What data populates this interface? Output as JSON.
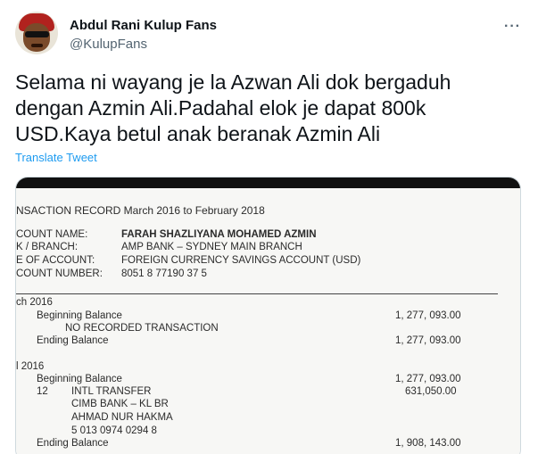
{
  "tweet": {
    "author_name": "Abdul Rani Kulup Fans",
    "author_handle": "@KulupFans",
    "more_icon": "more-horizontal-icon",
    "text_lines": [
      "Selama ni wayang je la Azwan Ali dok bergaduh",
      "dengan Azmin Ali.Padahal elok je dapat 800k",
      "USD.Kaya betul anak beranak Azmin Ali"
    ],
    "translate_label": "Translate Tweet"
  },
  "document": {
    "title": "NSACTION RECORD March 2016 to February 2018",
    "fields": [
      {
        "label": "COUNT NAME:",
        "value": "FARAH SHAZLIYANA MOHAMED AZMIN"
      },
      {
        "label": "K / BRANCH:",
        "value": "AMP BANK – SYDNEY MAIN BRANCH"
      },
      {
        "label": "E OF ACCOUNT:",
        "value": "FOREIGN CURRENCY SAVINGS ACCOUNT (USD)"
      },
      {
        "label": "COUNT NUMBER:",
        "value": "8051 8 77190 37 5"
      }
    ],
    "section1": {
      "period": "ch 2016",
      "opening_label": "Beginning Balance",
      "opening_amount": "1, 277, 093.00",
      "note": "NO RECORDED TRANSACTION",
      "closing_label": "Ending Balance",
      "closing_amount": "1, 277, 093.00"
    },
    "section2": {
      "period": "l 2016",
      "opening_label": "Beginning Balance",
      "opening_amount": "1, 277, 093.00",
      "txn_no": "12",
      "txn_desc": "INTL TRANSFER",
      "txn_amount": "631,050.00",
      "txn_bank": "CIMB BANK – KL BR",
      "txn_name": "AHMAD NUR HAKMA",
      "txn_ref": "5 013 0974 0294 8",
      "closing_label": "Ending Balance",
      "closing_amount": "1, 908, 143.00"
    }
  }
}
